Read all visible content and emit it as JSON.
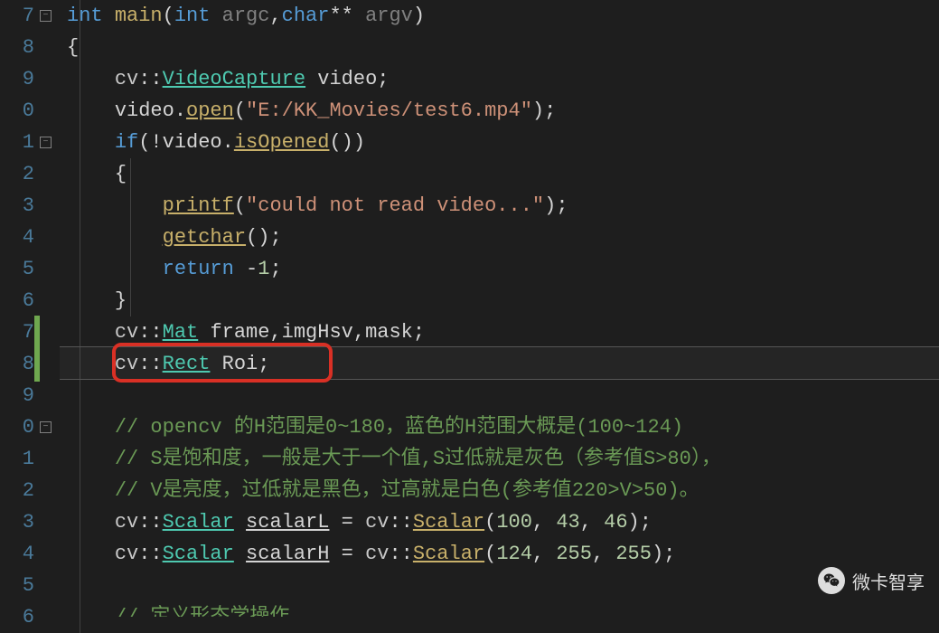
{
  "lineNumbers": [
    "7",
    "8",
    "9",
    "0",
    "1",
    "2",
    "3",
    "4",
    "5",
    "6",
    "7",
    "8",
    "9",
    "0",
    "1",
    "2",
    "3",
    "4",
    "5",
    "6"
  ],
  "watermark": "微卡智享",
  "code": {
    "l7": {
      "kw1": "int",
      "func": "main",
      "p1": "(",
      "kw2": "int",
      "arg1": " argc",
      "c": ",",
      "kw3": "char",
      "stars": "** ",
      "arg2": "argv",
      "p2": ")"
    },
    "l8": {
      "brace": "{"
    },
    "l9": {
      "ns": "cv",
      "cc": "::",
      "type": "VideoCapture",
      "sp": " ",
      "id": "video",
      "semi": ";"
    },
    "l10": {
      "id": "video",
      "dot": ".",
      "fn": "open",
      "p1": "(",
      "str": "\"E:/KK_Movies/test6.mp4\"",
      "p2": ")",
      "semi": ";"
    },
    "l11": {
      "kw": "if",
      "p1": "(",
      "bang": "!",
      "id": "video",
      "dot": ".",
      "fn": "isOpened",
      "p2": "()",
      ")": "",
      ")2": ")"
    },
    "l12": {
      "brace": "{"
    },
    "l13": {
      "fn": "printf",
      "p1": "(",
      "str": "\"could not read video...\"",
      "p2": ")",
      "semi": ";"
    },
    "l14": {
      "fn": "getchar",
      "p": "()",
      "semi": ";"
    },
    "l15": {
      "kw": "return",
      "sp": " ",
      "op": "-",
      "num": "1",
      "semi": ";"
    },
    "l16": {
      "brace": "}"
    },
    "l17": {
      "ns": "cv",
      "cc": "::",
      "type": "Mat",
      "sp": " ",
      "ids": "frame,imgHsv,mask",
      "semi": ";"
    },
    "l18": {
      "ns": "cv",
      "cc": "::",
      "type": "Rect",
      "sp": " ",
      "id": "Roi",
      "semi": ";"
    },
    "l20": {
      "cm": "// opencv 的H范围是0~180，蓝色的H范围大概是(100~124)"
    },
    "l21": {
      "cm": "// S是饱和度，一般是大于一个值,S过低就是灰色（参考值S>80），"
    },
    "l22": {
      "cm": "// V是亮度，过低就是黑色，过高就是白色(参考值220>V>50)。"
    },
    "l23": {
      "ns": "cv",
      "cc": "::",
      "type": "Scalar",
      "sp": " ",
      "id": "scalarL",
      "eq": " = ",
      "ns2": "cv",
      "cc2": "::",
      "fn": "Scalar",
      "p1": "(",
      "n1": "100",
      "c1": ", ",
      "n2": "43",
      "c2": ", ",
      "n3": "46",
      "p2": ")",
      "semi": ";"
    },
    "l24": {
      "ns": "cv",
      "cc": "::",
      "type": "Scalar",
      "sp": " ",
      "id": "scalarH",
      "eq": " = ",
      "ns2": "cv",
      "cc2": "::",
      "fn": "Scalar",
      "p1": "(",
      "n1": "124",
      "c1": ", ",
      "n2": "255",
      "c2": ", ",
      "n3": "255",
      "p2": ")",
      "semi": ";"
    },
    "l26": {
      "cm": "// 定义形态学操作"
    }
  }
}
